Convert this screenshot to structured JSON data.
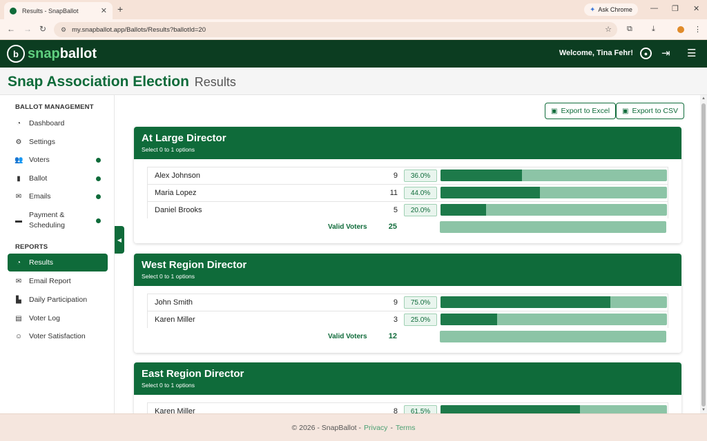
{
  "browser": {
    "tab_title": "Results - SnapBallot",
    "ask_chrome": "Ask Chrome",
    "url": "my.snapballot.app/Ballots/Results?ballotId=20"
  },
  "header": {
    "logo_prefix": "snap",
    "logo_suffix": "ballot",
    "welcome": "Welcome, Tina Fehr!"
  },
  "page": {
    "title": "Snap Association Election",
    "subtitle": "Results"
  },
  "sidebar": {
    "ballot_heading": "BALLOT MANAGEMENT",
    "reports_heading": "REPORTS",
    "ballot_items": [
      {
        "label": "Dashboard",
        "icon": "dashboard-icon",
        "dot": false
      },
      {
        "label": "Settings",
        "icon": "gear-icon",
        "dot": false
      },
      {
        "label": "Voters",
        "icon": "users-icon",
        "dot": true
      },
      {
        "label": "Ballot",
        "icon": "ballot-icon",
        "dot": true
      },
      {
        "label": "Emails",
        "icon": "envelope-icon",
        "dot": true
      },
      {
        "label": "Payment & Scheduling",
        "icon": "card-icon",
        "dot": true
      }
    ],
    "report_items": [
      {
        "label": "Results",
        "icon": "chart-icon",
        "active": true
      },
      {
        "label": "Email Report",
        "icon": "envelope-open-icon"
      },
      {
        "label": "Daily Participation",
        "icon": "bar-chart-icon"
      },
      {
        "label": "Voter Log",
        "icon": "log-icon"
      },
      {
        "label": "Voter Satisfaction",
        "icon": "smile-icon"
      }
    ]
  },
  "actions": {
    "export_excel": "Export to Excel",
    "export_csv": "Export to CSV"
  },
  "races": [
    {
      "title": "At Large Director",
      "subtitle": "Select 0 to 1 options",
      "candidates": [
        {
          "name": "Alex Johnson",
          "votes": "9",
          "pct": "36.0%",
          "fraction": 0.36
        },
        {
          "name": "Maria Lopez",
          "votes": "11",
          "pct": "44.0%",
          "fraction": 0.44
        },
        {
          "name": "Daniel Brooks",
          "votes": "5",
          "pct": "20.0%",
          "fraction": 0.2
        }
      ],
      "valid_label": "Valid Voters",
      "valid_count": "25"
    },
    {
      "title": "West Region Director",
      "subtitle": "Select 0 to 1 options",
      "candidates": [
        {
          "name": "John Smith",
          "votes": "9",
          "pct": "75.0%",
          "fraction": 0.75
        },
        {
          "name": "Karen Miller",
          "votes": "3",
          "pct": "25.0%",
          "fraction": 0.25
        }
      ],
      "valid_label": "Valid Voters",
      "valid_count": "12"
    },
    {
      "title": "East Region Director",
      "subtitle": "Select 0 to 1 options",
      "candidates": [
        {
          "name": "Karen Miller",
          "votes": "8",
          "pct": "61.5%",
          "fraction": 0.615
        }
      ]
    }
  ],
  "footer": {
    "copyright": "© 2026 - SnapBallot -",
    "privacy": "Privacy",
    "separator": "-",
    "terms": "Terms"
  },
  "colors": {
    "brand_green": "#0f6b3a",
    "header_dark": "#0c3d21",
    "bar_fill": "#1d7a4a",
    "bar_track": "#8cc4a6"
  }
}
